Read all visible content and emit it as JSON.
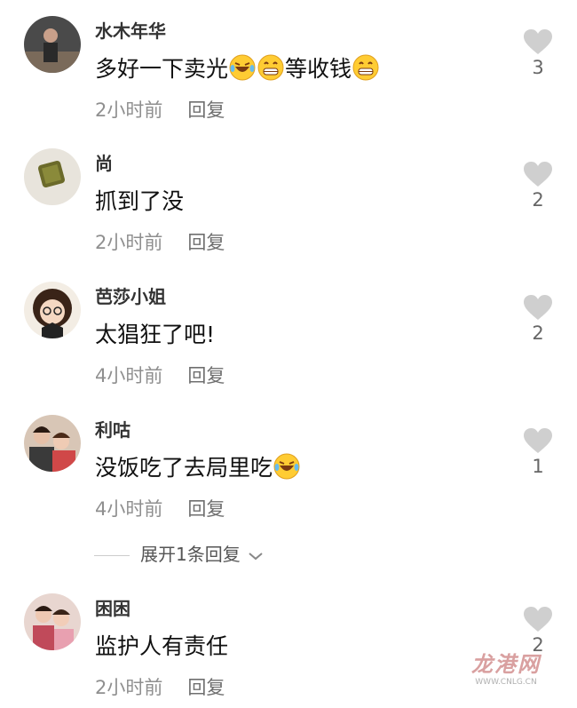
{
  "comments": [
    {
      "username": "水木年华",
      "text_parts": [
        "多好一下卖光",
        "",
        "",
        "等收钱",
        ""
      ],
      "time": "2小时前",
      "reply": "回复",
      "likes": "3"
    },
    {
      "username": "尚",
      "text": "抓到了没",
      "time": "2小时前",
      "reply": "回复",
      "likes": "2"
    },
    {
      "username": "芭莎小姐",
      "text": "太猖狂了吧!",
      "time": "4小时前",
      "reply": "回复",
      "likes": "2"
    },
    {
      "username": "利咕",
      "text": "没饭吃了去局里吃",
      "time": "4小时前",
      "reply": "回复",
      "likes": "1"
    },
    {
      "username": "困困",
      "text": "监护人有责任",
      "time": "2小时前",
      "reply": "回复",
      "likes": "2"
    }
  ],
  "expand_replies": "展开1条回复",
  "watermark": {
    "logo": "龙港网",
    "url": "WWW.CNLG.CN"
  },
  "icons": {
    "like": "heart-icon",
    "expand": "chevron-down-icon",
    "emoji_laugh": "laughing-tears-emoji",
    "emoji_grin": "grinning-emoji"
  },
  "colors": {
    "heart": "#cfcfcf",
    "meta": "#8f8f8f",
    "emoji": "#ffcc33"
  }
}
